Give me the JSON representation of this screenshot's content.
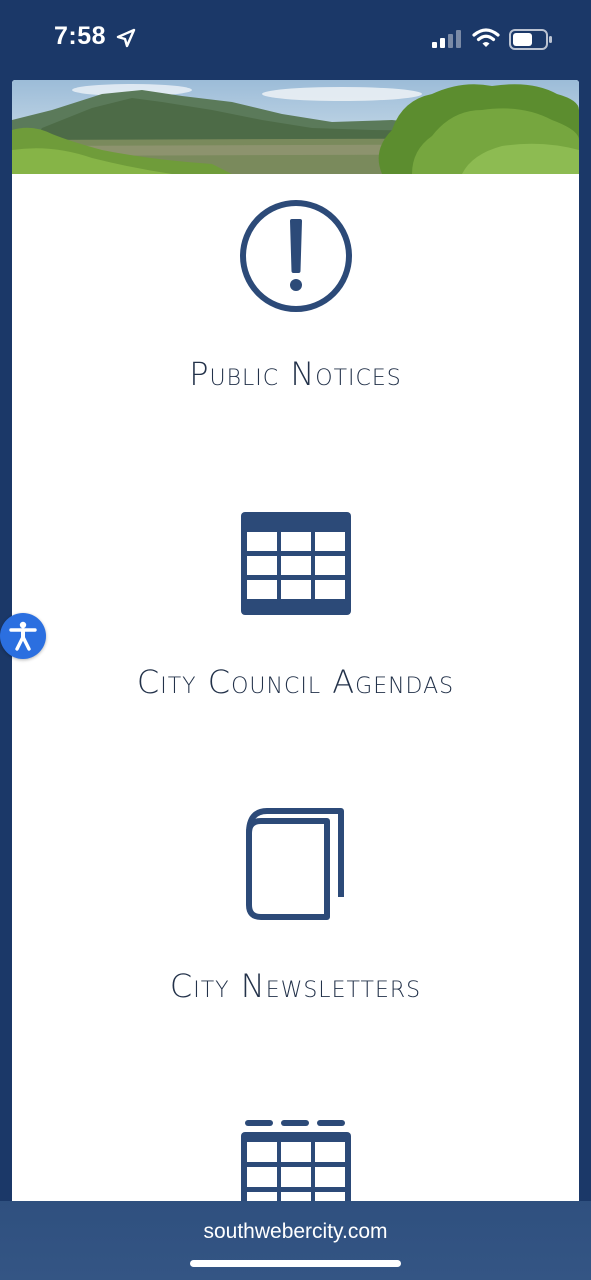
{
  "status_bar": {
    "time": "7:58",
    "icons": [
      "location-arrow-icon",
      "cellular-signal-icon",
      "wifi-icon",
      "battery-icon"
    ]
  },
  "hero": {
    "image": "mountain-landscape-banner"
  },
  "tiles": [
    {
      "label": "Public Notices",
      "icon": "exclamation-circle-icon"
    },
    {
      "label": "City Council Agendas",
      "icon": "calendar-grid-icon"
    },
    {
      "label": "City Newsletters",
      "icon": "book-icon"
    },
    {
      "label": "",
      "icon": "calendar-icon"
    }
  ],
  "accessibility": {
    "icon": "accessibility-person-icon"
  },
  "browser": {
    "url": "southwebercity.com"
  },
  "colors": {
    "page_background": "#1b3868",
    "icon_color": "#2c4a78",
    "label_color": "#23324a",
    "accessibility_button": "#2b6fe0",
    "url_bar": "#2f507f"
  }
}
